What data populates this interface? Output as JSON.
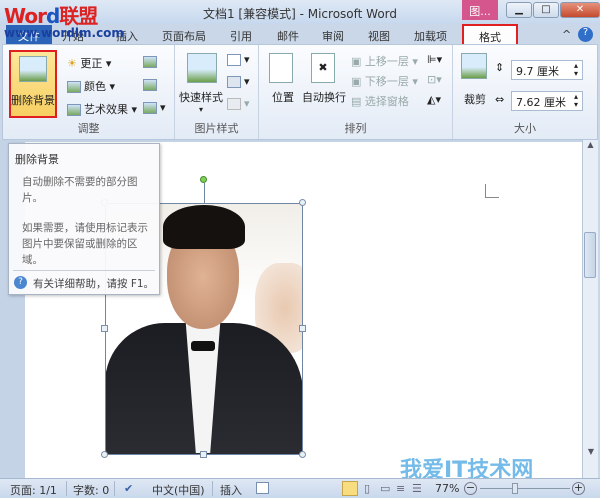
{
  "window": {
    "title": "文档1 [兼容模式] - Microsoft Word",
    "context_tab": "图...",
    "logo": "Word联盟",
    "logo_url": "www.wordlm.com"
  },
  "tabs": [
    "文件",
    "开始",
    "插入",
    "页面布局",
    "引用",
    "邮件",
    "审阅",
    "视图",
    "加载项",
    "格式"
  ],
  "ribbon": {
    "adjust": {
      "label": "调整",
      "remove_bg": "删除背景",
      "corrections": "更正",
      "color": "颜色",
      "artistic": "艺术效果"
    },
    "styles": {
      "label": "图片样式",
      "quick": "快速样式"
    },
    "arrange": {
      "label": "排列",
      "position": "位置",
      "wrap": "自动换行",
      "bring_forward": "上移一层",
      "send_backward": "下移一层",
      "selection_pane": "选择窗格"
    },
    "size": {
      "label": "大小",
      "crop": "裁剪",
      "height": "9.7 厘米",
      "width": "7.62 厘米"
    }
  },
  "tooltip": {
    "title": "删除背景",
    "desc1": "自动删除不需要的部分图片。",
    "desc2": "如果需要，请使用标记表示图片中要保留或删除的区域。",
    "help": "有关详细帮助，请按 F1。"
  },
  "status": {
    "page": "页面: 1/1",
    "words": "字数: 0",
    "language": "中文(中国)",
    "mode": "插入",
    "zoom": "77%"
  },
  "watermark": "我爱IT技术网"
}
